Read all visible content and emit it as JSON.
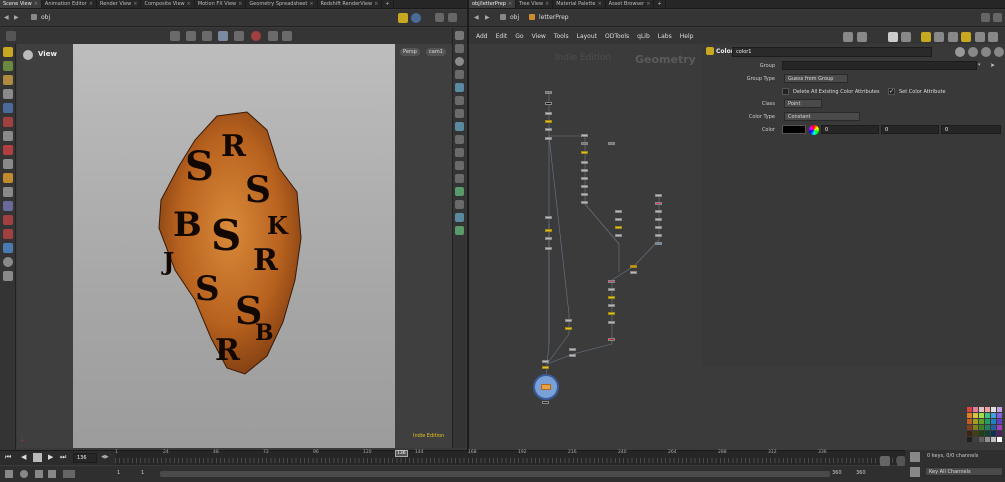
{
  "left_tabs": [
    "Scene View",
    "Animation Editor",
    "Render View",
    "Composite View",
    "Motion FX View",
    "Geometry Spreadsheet",
    "Redshift RenderView"
  ],
  "right_tabs": [
    "obj/letterPrep",
    "Tree View",
    "Material Palette",
    "Asset Browser"
  ],
  "left_path": "obj",
  "right_path": [
    "obj",
    "letterPrep"
  ],
  "viewport": {
    "title": "View",
    "persp_button": "Persp",
    "cam_button": "cam1",
    "watermark": "Indie Edition"
  },
  "network": {
    "menu": [
      "Add",
      "Edit",
      "Go",
      "View",
      "Tools",
      "Layout",
      "ODTools",
      "qLib",
      "Labs",
      "Help"
    ],
    "watermark_edition": "Indie Edition",
    "watermark_context": "Geometry"
  },
  "parms": {
    "node_type": "Color",
    "node_name": "color1",
    "group_label": "Group",
    "group_type_label": "Group Type",
    "group_type_value": "Guess from Group",
    "delete_attrs_label": "Delete All Existing Color Attributes",
    "set_color_label": "Set Color Attribute",
    "class_label": "Class",
    "class_value": "Point",
    "color_type_label": "Color Type",
    "color_type_value": "Constant",
    "color_label": "Color",
    "color_values": [
      "0",
      "0",
      "0"
    ]
  },
  "timeline": {
    "current_frame": "136",
    "ticks": [
      "1",
      "24",
      "48",
      "72",
      "96",
      "120",
      "136",
      "144",
      "168",
      "192",
      "216",
      "240",
      "264",
      "288",
      "312",
      "336"
    ],
    "start_frame": "1",
    "start_frame_2": "1",
    "end_frame": "360",
    "end_frame_2": "360"
  },
  "keys": {
    "status": "0 keys, 0/0 channels",
    "filter": "Key All Channels"
  },
  "colors": {
    "accent_yellow": "#e3c020",
    "viewport_bg": "#b4b4b4",
    "rock": "#c06a2a"
  }
}
